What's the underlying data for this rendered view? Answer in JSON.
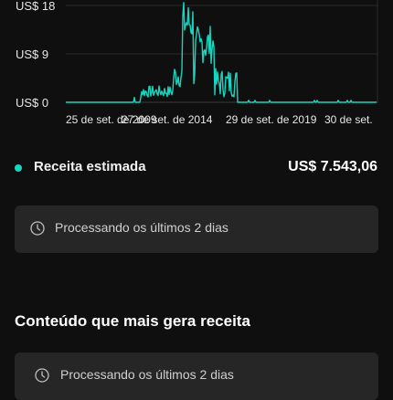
{
  "chart": {
    "y_labels": [
      "US$ 18",
      "US$ 9",
      "US$ 0"
    ],
    "x_labels": [
      "25 de set. de 2009",
      "27 de set. de 2014",
      "29 de set. de 2019",
      "30 de set."
    ],
    "line_color": "#16d6c0"
  },
  "metric": {
    "label": "Receita estimada",
    "value": "US$ 7.543,06",
    "dot_color": "#16d6c0"
  },
  "processing_card_1": {
    "icon": "clock-icon",
    "text": "Processando os últimos 2 dias"
  },
  "section": {
    "title": "Conteúdo que mais gera receita"
  },
  "processing_card_2": {
    "icon": "clock-icon",
    "text": "Processando os últimos 2 dias"
  }
}
